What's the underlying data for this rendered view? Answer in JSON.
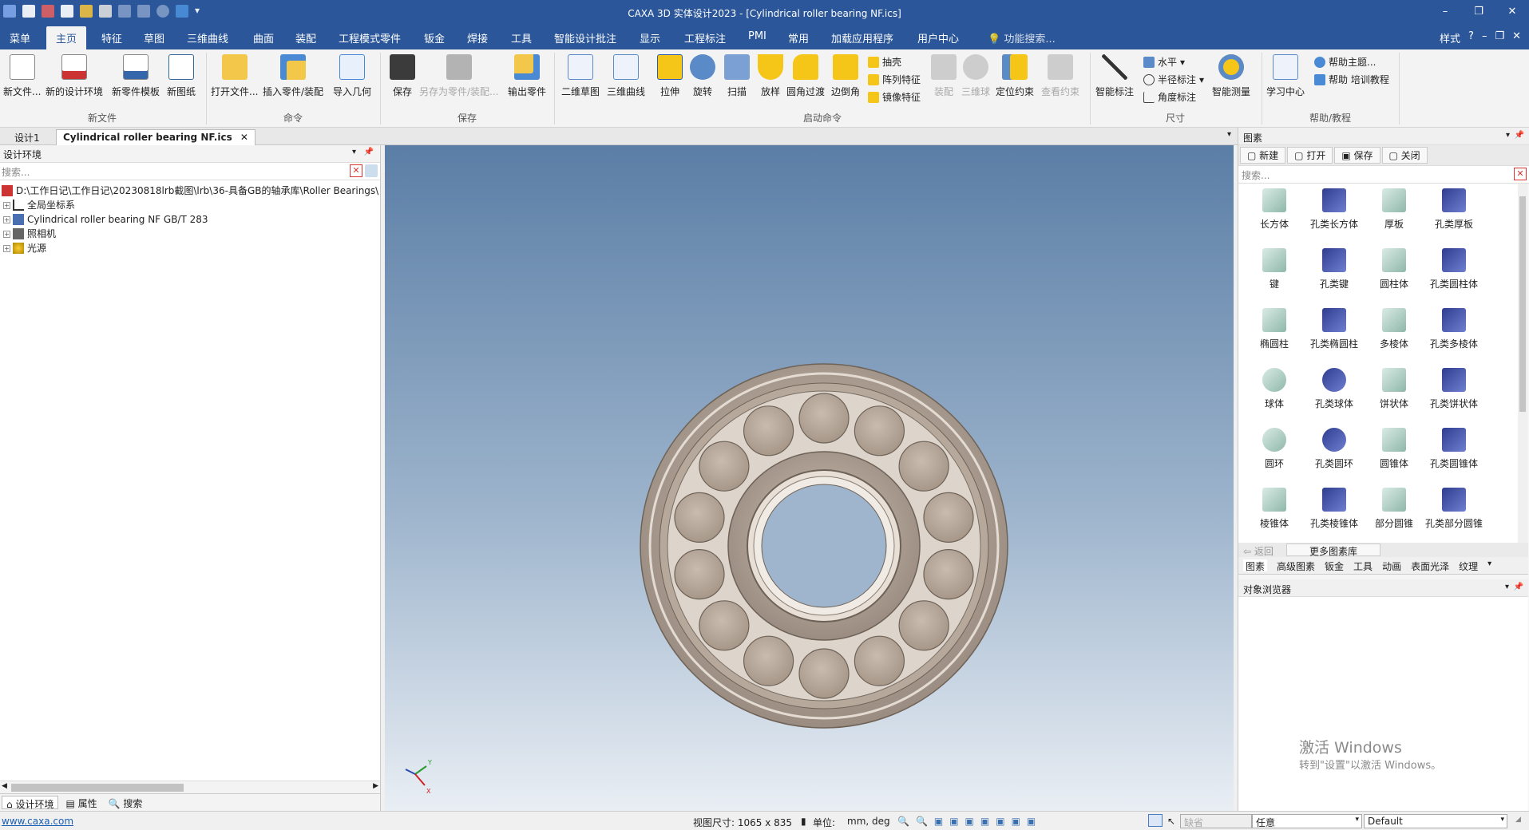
{
  "window": {
    "title": "CAXA 3D 实体设计2023 - [Cylindrical roller bearing NF.ics]"
  },
  "menu_tabs": [
    "菜单",
    "主页",
    "特征",
    "草图",
    "三维曲线",
    "曲面",
    "装配",
    "工程模式零件",
    "钣金",
    "焊接",
    "工具",
    "智能设计批注",
    "显示",
    "工程标注",
    "PMI",
    "常用",
    "加载应用程序",
    "用户中心"
  ],
  "feature_search": "功能搜索...",
  "style_label": "样式",
  "ribbon": {
    "new_file": {
      "label": "新文件",
      "buttons": [
        "新文件...",
        "新的设计环境",
        "新零件模板",
        "新图纸"
      ]
    },
    "command": {
      "label": "命令",
      "buttons": [
        "打开文件...",
        "插入零件/装配",
        "导入几何"
      ]
    },
    "save": {
      "label": "保存",
      "buttons": [
        "保存",
        "另存为零件/装配...",
        "输出零件"
      ]
    },
    "launch": {
      "label": "启动命令",
      "buttons": [
        "二维草图",
        "三维曲线",
        "拉伸",
        "旋转",
        "扫描",
        "放样",
        "圆角过渡",
        "边倒角"
      ],
      "small": [
        "抽壳",
        "阵列特征",
        "镜像特征"
      ],
      "disabled": [
        "装配",
        "三维球",
        "查看约束"
      ],
      "locate": "定位约束"
    },
    "size": {
      "label": "尺寸",
      "smart": "智能标注",
      "small": [
        "水平",
        "半径标注",
        "角度标注"
      ],
      "measure": "智能测量"
    },
    "help": {
      "label": "帮助/教程",
      "learn": "学习中心",
      "small": [
        "帮助主题...",
        "帮助 培训教程"
      ]
    }
  },
  "doc_tabs": [
    "设计1",
    "Cylindrical roller bearing NF.ics"
  ],
  "left_panel": {
    "title": "设计环境",
    "search_placeholder": "搜索...",
    "tree": [
      "D:\\工作日记\\工作日记\\20230818lrb截图\\lrb\\36-具备GB的轴承库\\Roller Bearings\\",
      "全局坐标系",
      "Cylindrical roller bearing NF GB/T 283",
      "照相机",
      "光源"
    ],
    "bottom_tabs": [
      "设计环境",
      "属性",
      "搜索"
    ]
  },
  "right_panel": {
    "title": "图素",
    "buttons": [
      "新建",
      "打开",
      "保存",
      "关闭"
    ],
    "search_placeholder": "搜索...",
    "shapes": [
      "长方体",
      "孔类长方体",
      "厚板",
      "孔类厚板",
      "键",
      "孔类键",
      "圆柱体",
      "孔类圆柱体",
      "椭圆柱",
      "孔类椭圆柱",
      "多棱体",
      "孔类多棱体",
      "球体",
      "孔类球体",
      "饼状体",
      "孔类饼状体",
      "圆环",
      "孔类圆环",
      "圆锥体",
      "孔类圆锥体",
      "棱锥体",
      "孔类棱锥体",
      "部分圆锥",
      "孔类部分圆锥"
    ],
    "nav_back": "返回",
    "nav_more": "更多图素库",
    "tabs": [
      "图素",
      "高级图素",
      "钣金",
      "工具",
      "动画",
      "表面光泽",
      "纹理"
    ],
    "object_browser": "对象浏览器",
    "watermark": [
      "激活 Windows",
      "转到\"设置\"以激活 Windows。"
    ]
  },
  "status": {
    "url": "www.caxa.com",
    "view_size": "视图尺寸: 1065 x  835",
    "unit_label": "单位:",
    "unit_value": "mm, deg",
    "combo1": "缺省",
    "combo2": "任意",
    "combo3": "Default"
  },
  "colors": {
    "titlebar": "#2b579a",
    "bearing": "#b5a79a",
    "viewport_top": "#5b7ea6",
    "viewport_bottom": "#e9eef4"
  }
}
